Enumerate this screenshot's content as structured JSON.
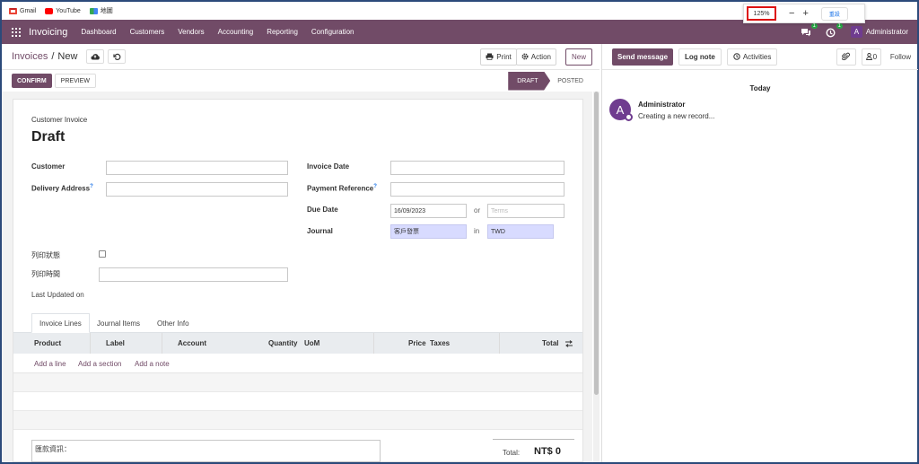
{
  "bookmarks": [
    {
      "label": "Gmail",
      "icon": "gmail-icon",
      "color": "#ea4335"
    },
    {
      "label": "YouTube",
      "icon": "youtube-icon",
      "color": "#ff0000"
    },
    {
      "label": "地圖",
      "icon": "maps-icon",
      "color": "#34a853"
    }
  ],
  "zoom": {
    "value": "125%",
    "minus": "−",
    "plus": "+",
    "reset": "重設"
  },
  "topnav": {
    "brand": "Invoicing",
    "menu": [
      "Dashboard",
      "Customers",
      "Vendors",
      "Accounting",
      "Reporting",
      "Configuration"
    ],
    "messages_count": "1",
    "activities_count": "1",
    "user_initial": "A",
    "user_name": "Administrator",
    "brand_color": "#714b67"
  },
  "control": {
    "breadcrumb_parent": "Invoices",
    "breadcrumb_sep": "/",
    "breadcrumb_current": "New",
    "print": "Print",
    "action": "Action",
    "new": "New"
  },
  "status": {
    "confirm": "CONFIRM",
    "preview": "PREVIEW",
    "stage_draft": "DRAFT",
    "stage_posted": "POSTED"
  },
  "form": {
    "doc_type": "Customer Invoice",
    "title": "Draft",
    "customer_label": "Customer",
    "delivery_label": "Delivery Address",
    "invoice_date_label": "Invoice Date",
    "payment_ref_label": "Payment Reference",
    "due_date_label": "Due Date",
    "due_date_value": "16/09/2023",
    "or": "or",
    "terms_placeholder": "Terms",
    "journal_label": "Journal",
    "journal_value": "客戶發票",
    "in": "in",
    "currency_value": "TWD",
    "print_status_label": "列印狀態",
    "print_time_label": "列印時間",
    "last_updated_label": "Last Updated on",
    "help_mark": "?"
  },
  "tabs": [
    "Invoice Lines",
    "Journal Items",
    "Other Info"
  ],
  "lines_table": {
    "columns": [
      "Product",
      "Label",
      "Account",
      "Quantity",
      "UoM",
      "Price",
      "Taxes",
      "Total"
    ],
    "add_line": "Add a line",
    "add_section": "Add a section",
    "add_note": "Add a note"
  },
  "footer": {
    "notes_text": "匯款資訊：",
    "total_label": "Total:",
    "total_value": "NT$ 0"
  },
  "chatter": {
    "send_message": "Send message",
    "log_note": "Log note",
    "activities": "Activities",
    "followers_count": "0",
    "follow": "Follow",
    "today": "Today",
    "author_initial": "A",
    "author": "Administrator",
    "message": "Creating a new record..."
  }
}
